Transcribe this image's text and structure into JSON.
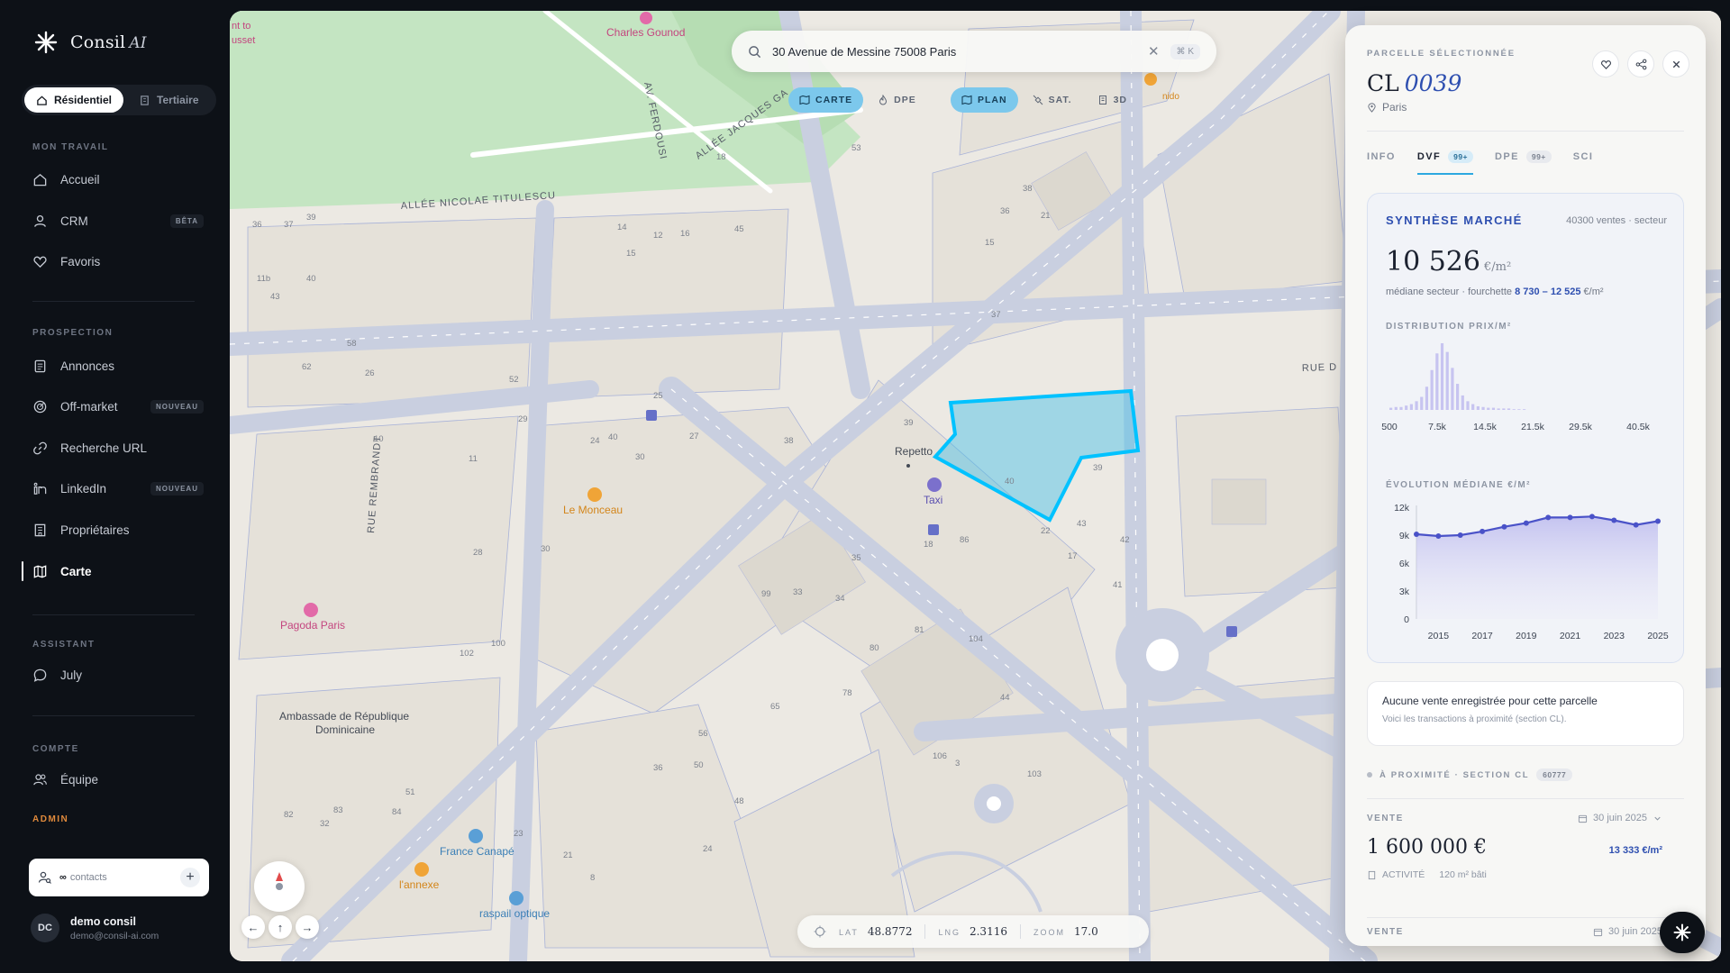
{
  "app": {
    "name": "Consil",
    "name_suffix": "AI"
  },
  "segment": {
    "items": [
      "Résidentiel",
      "Tertiaire"
    ],
    "selected": "Résidentiel"
  },
  "sidebar": {
    "sections": {
      "work": "MON TRAVAIL",
      "prospection": "PROSPECTION",
      "assistant": "ASSISTANT",
      "account": "COMPTE",
      "admin": "ADMIN"
    },
    "items": {
      "accueil": "Accueil",
      "crm": "CRM",
      "crm_badge": "BÊTA",
      "favoris": "Favoris",
      "annonces": "Annonces",
      "offmarket": "Off-market",
      "offmarket_badge": "NOUVEAU",
      "recherche": "Recherche URL",
      "linkedin": "LinkedIn",
      "linkedin_badge": "NOUVEAU",
      "proprietaires": "Propriétaires",
      "carte": "Carte",
      "july": "July",
      "equipe": "Équipe"
    },
    "active": "Carte",
    "contacts": {
      "value": "∞",
      "label": "contacts"
    },
    "user": {
      "initials": "DC",
      "name": "demo consil",
      "email": "demo@consil-ai.com"
    }
  },
  "map": {
    "search": {
      "value": "30 Avenue de Messine 75008 Paris",
      "shortcut": "⌘ K"
    },
    "layers_mode": [
      {
        "label": "CARTE",
        "active": true
      },
      {
        "label": "DPE",
        "active": false
      }
    ],
    "layers_base": [
      {
        "label": "PLAN",
        "active": true
      },
      {
        "label": "SAT.",
        "active": false
      },
      {
        "label": "3D",
        "active": false
      }
    ],
    "streets": {
      "s1": "ALLÉE NICOLAE TITULESCU",
      "s2": "AV. FERDOUSI",
      "s3": "ALLÉE JACQUES GA",
      "s4": "RUE REMBRANDT",
      "s5": "RUE D"
    },
    "pois": {
      "p1": "Charles Gounod",
      "p2": "Le Monceau",
      "p3": "Pagoda Paris",
      "p4": "Repetto",
      "p5": "Taxi",
      "p6": "Ambassade de République",
      "p6b": "Dominicaine",
      "p7": "France Canapé",
      "p8": "l'annexe",
      "p9": "raspail optique",
      "p10": "nido",
      "p11": "nt to",
      "p12": "usset"
    },
    "lot_numbers": [
      "18",
      "53",
      "45",
      "16",
      "15",
      "14",
      "12",
      "36",
      "37",
      "39",
      "11b",
      "40",
      "43",
      "58",
      "52",
      "62",
      "29",
      "24",
      "40",
      "27",
      "25",
      "26",
      "10",
      "11",
      "30",
      "30",
      "28",
      "99",
      "100",
      "102",
      "33",
      "34",
      "35",
      "86",
      "81",
      "80",
      "78",
      "65",
      "56",
      "48",
      "36",
      "50",
      "51",
      "84",
      "82",
      "83",
      "32",
      "24",
      "23",
      "21",
      "8",
      "18",
      "17",
      "44",
      "41",
      "42",
      "43",
      "40",
      "22",
      "39",
      "37",
      "38",
      "36",
      "21",
      "15",
      "104",
      "106",
      "103",
      "3",
      "38",
      "39"
    ],
    "coords": {
      "lat_label": "LAT",
      "lat": "48.8772",
      "lng_label": "LNG",
      "lng": "2.3116",
      "zoom_label": "ZOOM",
      "zoom": "17.0"
    },
    "compass_n": "N",
    "arrows": {
      "left": "←",
      "up": "↑",
      "right": "→"
    }
  },
  "panel": {
    "eyebrow": "PARCELLE SÉLECTIONNÉE",
    "title_prefix": "CL",
    "title_num": "0039",
    "location": "Paris",
    "tabs": [
      {
        "label": "INFO",
        "count": ""
      },
      {
        "label": "DVF",
        "count": "99+"
      },
      {
        "label": "DPE",
        "count": "99+"
      },
      {
        "label": "SCI",
        "count": ""
      }
    ],
    "active_tab": "DVF",
    "market": {
      "title": "SYNTHÈSE MARCHÉ",
      "sales": "40300 ventes · secteur",
      "median": "10 526",
      "unit": "€/m²",
      "note_prefix": "médiane secteur · fourchette ",
      "range": "8 730 – 12 525",
      "range_unit": " €/m²",
      "dist_label": "DISTRIBUTION PRIX/M²",
      "evo_label": "ÉVOLUTION MÉDIANE €/M²"
    },
    "empty": {
      "title": "Aucune vente enregistrée pour cette parcelle",
      "sub": "Voici les transactions à proximité (section CL)."
    },
    "nearby": {
      "label": "À PROXIMITÉ · SECTION CL",
      "count": "60777"
    },
    "sales": [
      {
        "type": "VENTE",
        "date": "30 juin 2025",
        "price": "1 600 000 €",
        "ppm": "13 333 €/m²",
        "kind": "ACTIVITÉ",
        "area": "120 m² bâti"
      },
      {
        "type": "VENTE",
        "date": "30 juin 2025",
        "price": "",
        "ppm": "",
        "kind": "",
        "area": ""
      }
    ]
  },
  "chart_data": [
    {
      "type": "bar",
      "title": "DISTRIBUTION PRIX/M²",
      "x_ticks": [
        "500",
        "7.5k",
        "14.5k",
        "21.5k",
        "29.5k",
        "40.5k"
      ],
      "x": [
        500,
        1500,
        2500,
        3500,
        4500,
        5500,
        6500,
        7500,
        8500,
        9500,
        10500,
        11500,
        12500,
        13500,
        14500,
        15500,
        16500,
        17500,
        18500,
        19500,
        20500,
        21500,
        22500,
        23500,
        24500,
        25500,
        26500
      ],
      "values": [
        3,
        4,
        4,
        6,
        8,
        12,
        18,
        32,
        55,
        78,
        92,
        80,
        58,
        36,
        20,
        12,
        8,
        5,
        4,
        3,
        3,
        2,
        2,
        2,
        1,
        1,
        1
      ],
      "xlim": [
        500,
        40500
      ],
      "grid": false
    },
    {
      "type": "area",
      "title": "ÉVOLUTION MÉDIANE €/M²",
      "x": [
        2014,
        2015,
        2016,
        2017,
        2018,
        2019,
        2020,
        2021,
        2022,
        2023,
        2024,
        2025
      ],
      "values": [
        9100,
        8900,
        9000,
        9400,
        9900,
        10300,
        10900,
        10900,
        11000,
        10600,
        10100,
        10500
      ],
      "x_ticks": [
        "2015",
        "2017",
        "2019",
        "2021",
        "2023",
        "2025"
      ],
      "y_ticks": [
        "0",
        "3k",
        "6k",
        "9k",
        "12k"
      ],
      "ylim": [
        0,
        12000
      ],
      "color": "#4a52c8"
    }
  ],
  "colors": {
    "accent": "#2e4fb0",
    "selection": "#00c2ff",
    "layer_active": "#7cc8ec"
  }
}
